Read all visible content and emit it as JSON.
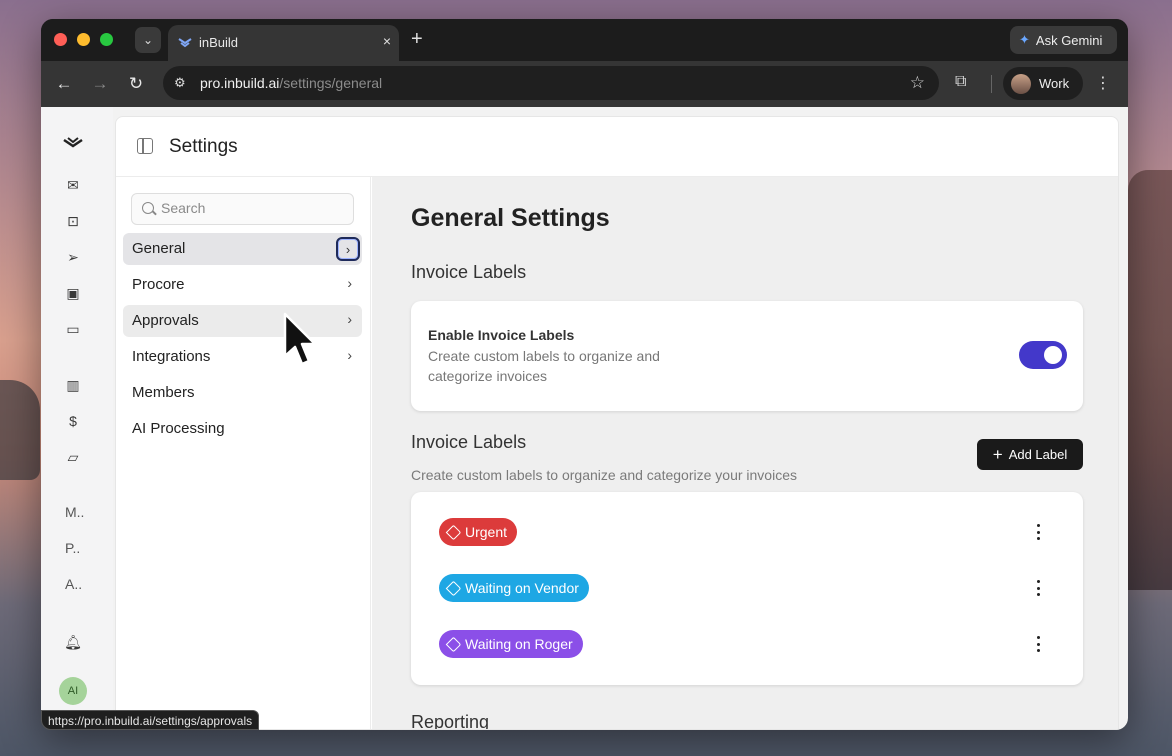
{
  "browser": {
    "tab_title": "inBuild",
    "new_tab_symbol": "+",
    "tab_close_symbol": "×",
    "gemini_label": "Ask Gemini",
    "url_host": "pro.inbuild.ai",
    "url_path": "/settings/general",
    "profile_label": "Work",
    "status_url": "https://pro.inbuild.ai/settings/approvals"
  },
  "rail": {
    "items": [
      "logo-icon",
      "mail-icon",
      "inbox-icon",
      "send-icon",
      "archive-icon",
      "card-icon",
      "chart-icon",
      "dollar-doc-icon",
      "folder-icon"
    ],
    "short_labels": [
      "M..",
      "P..",
      "A.."
    ],
    "avatar_initials": "AI"
  },
  "header": {
    "title": "Settings"
  },
  "settings_nav": {
    "search_placeholder": "Search",
    "items": [
      {
        "label": "General",
        "has_chevron": true,
        "state": "active"
      },
      {
        "label": "Procore",
        "has_chevron": true
      },
      {
        "label": "Approvals",
        "has_chevron": true,
        "state": "hover"
      },
      {
        "label": "Integrations",
        "has_chevron": true
      },
      {
        "label": "Members",
        "has_chevron": false
      },
      {
        "label": "AI Processing",
        "has_chevron": false
      }
    ]
  },
  "content": {
    "page_title": "General Settings",
    "section1_title": "Invoice Labels",
    "toggle": {
      "title": "Enable Invoice Labels",
      "description": "Create custom labels to organize and categorize invoices",
      "enabled": true
    },
    "section2_title": "Invoice Labels",
    "section2_desc": "Create custom labels to organize and categorize your invoices",
    "add_label_button": "Add Label",
    "labels": [
      {
        "name": "Urgent",
        "color": "#dc3b3b"
      },
      {
        "name": "Waiting on Vendor",
        "color": "#1ea7e4"
      },
      {
        "name": "Waiting on Roger",
        "color": "#8b4fe8"
      }
    ],
    "next_section_peek": "Reporting"
  },
  "colors": {
    "accent": "#4338ca",
    "active_nav": "#e4e4e7"
  }
}
